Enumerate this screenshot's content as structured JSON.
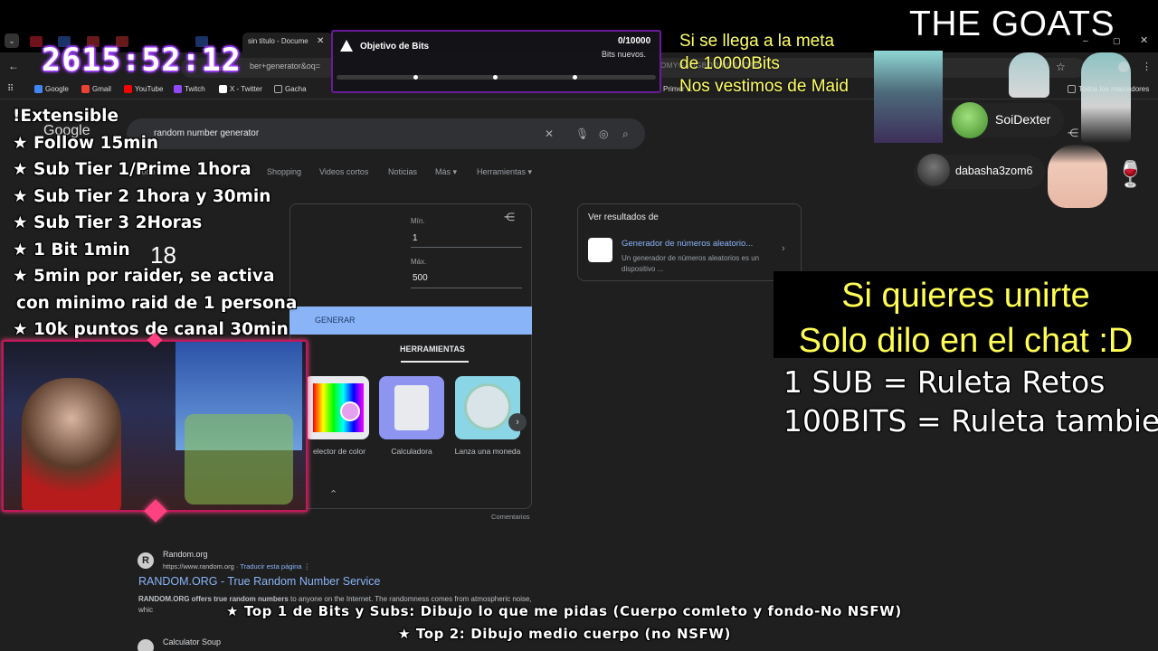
{
  "browser": {
    "active_tab_title": "sin título - Docume",
    "omnibox_text": "ber+generator&oq=",
    "omnibox_tail": "OMYGAOGBODIHCAAQAB",
    "bookmarks": [
      {
        "label": "Google",
        "color": "#4285f4"
      },
      {
        "label": "Gmail",
        "color": "#ea4335"
      },
      {
        "label": "YouTube",
        "color": "#ff0000"
      },
      {
        "label": "Twitch",
        "color": "#9146ff"
      },
      {
        "label": "X - Twitter",
        "color": "#ffffff"
      },
      {
        "label": "Gacha",
        "color": "#888888"
      }
    ],
    "bookmarks_folder_right": "Todos los marcadores",
    "bookmarks_folder_mid": "Primer ..."
  },
  "google": {
    "logo": "Google",
    "search_value": "random number generator",
    "nav_tabs": [
      "Todo",
      "Shopping",
      "Videos cortos",
      "Noticias",
      "Más",
      "Herramientas"
    ],
    "rng": {
      "min_label": "Mín.",
      "min_value": "1",
      "max_label": "Máx.",
      "max_value": "500",
      "generate_label": "GENERAR",
      "tools_tab": "HERRAMIENTAS",
      "tools": [
        "elector de color",
        "Calculadora",
        "Lanza una moneda"
      ],
      "comments": "Comentarios"
    },
    "side_panel": {
      "title": "Ver resultados de",
      "link": "Generador de números aleatorio...",
      "desc": "Un generador de números aleatorios es un dispositivo ..."
    },
    "result": {
      "site": "Random.org",
      "url": "https://www.random.org",
      "translate": "Traducir esta página",
      "title": "RANDOM.ORG - True Random Number Service",
      "snippet_bold": "RANDOM.ORG offers true random numbers",
      "snippet_rest": " to anyone on the Internet. The randomness comes from atmospheric noise, whic"
    },
    "result2_site": "Calculator Soup"
  },
  "overlay": {
    "timer": "2615:52:12",
    "bits": {
      "title": "Objetivo de Bits",
      "count": "0/10000",
      "subtitle": "Bits nuevos."
    },
    "goal_lines": [
      "Si se llega a la meta",
      "de 10000Bits",
      "Nos vestimos de Maid"
    ],
    "brand": "THE GOATS",
    "rules_title": "!Extensible",
    "rules": [
      "★ Follow 15min",
      "★ Sub Tier 1/Prime 1hora",
      "★ Sub Tier 2 1hora y 30min",
      "★ Sub Tier 3 2Horas",
      "★ 1 Bit 1min",
      "★ 5min por raider, se activa",
      "con minimo raid de 1 persona",
      "★ 10k puntos de canal 30min"
    ],
    "counter": "18",
    "viewers": [
      "SoiDexter",
      "dabasha3zom6"
    ],
    "join_lines": [
      "Si quieres unirte",
      "Solo dilo en el chat :D"
    ],
    "roulette_lines": [
      "1 SUB = Ruleta Retos",
      "100BITS = Ruleta tambie"
    ],
    "bottom_lines": [
      "★ Top 1 de Bits y Subs: Dibujo lo que me pidas (Cuerpo comleto y fondo-No NSFW)",
      "★ Top 2: Dibujo medio cuerpo (no NSFW)"
    ]
  },
  "colors": {
    "timer_glow": "#9b30ff",
    "goal_yellow": "#ffff66",
    "join_yellow": "#ffff55",
    "webcam_border": "#c2185b",
    "link_blue": "#8ab4f8"
  }
}
